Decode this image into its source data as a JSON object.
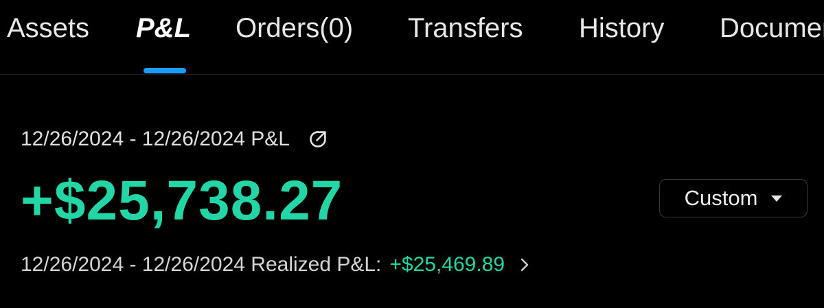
{
  "tabs": [
    {
      "label": "Assets",
      "active": false
    },
    {
      "label": "P&L",
      "active": true
    },
    {
      "label": "Orders(0)",
      "active": false
    },
    {
      "label": "Transfers",
      "active": false
    },
    {
      "label": "History",
      "active": false
    },
    {
      "label": "Documents",
      "active": false
    }
  ],
  "summary": {
    "period_label": "12/26/2024 - 12/26/2024 P&L",
    "share_icon": "share-icon",
    "total_pnl": "+$25,738.27",
    "range_selector": {
      "selected": "Custom",
      "icon": "caret-down-icon"
    },
    "realized_label": "12/26/2024 - 12/26/2024 Realized P&L:",
    "realized_value": "+$25,469.89",
    "realized_icon": "chevron-right-icon"
  },
  "colors": {
    "background": "#000000",
    "positive": "#23d6a6",
    "tab_indicator": "#1e9bff",
    "text_primary": "#e8e8e8"
  }
}
